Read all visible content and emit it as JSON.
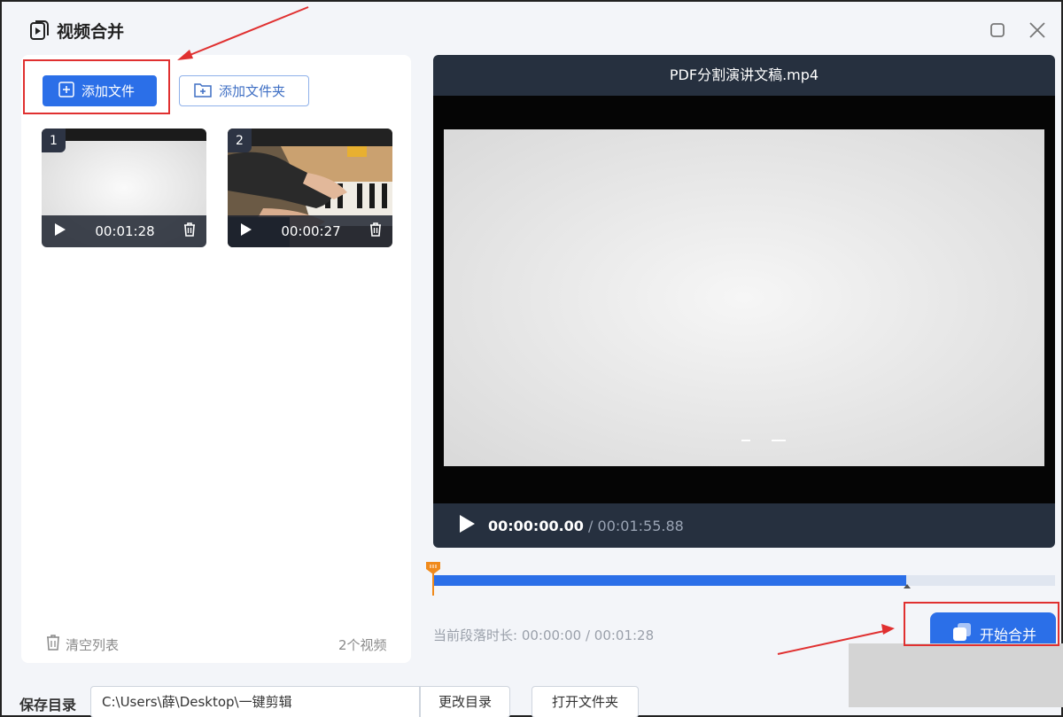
{
  "app": {
    "title": "视频合并"
  },
  "toolbar": {
    "add_file_label": "添加文件",
    "add_folder_label": "添加文件夹"
  },
  "clips": [
    {
      "index": "1",
      "duration": "00:01:28"
    },
    {
      "index": "2",
      "duration": "00:00:27"
    }
  ],
  "list_footer": {
    "clear_label": "清空列表",
    "count_label": "2个视频"
  },
  "player": {
    "title": "PDF分割演讲文稿.mp4",
    "current_time": "00:00:00.00",
    "separator": "/",
    "total_time": "00:01:55.88",
    "progress": 0.76
  },
  "segment": {
    "label": "当前段落时长: 00:00:00 / 00:01:28"
  },
  "start_button": {
    "label": "开始合并"
  },
  "output": {
    "save_label": "保存目录",
    "path": "C:\\Users\\薛\\Desktop\\一键剪辑",
    "change_dir_label": "更改目录",
    "open_folder_label": "打开文件夹"
  },
  "colors": {
    "accent": "#2b6fe8",
    "player_bg": "#26303f",
    "annotation": "#e03030"
  }
}
